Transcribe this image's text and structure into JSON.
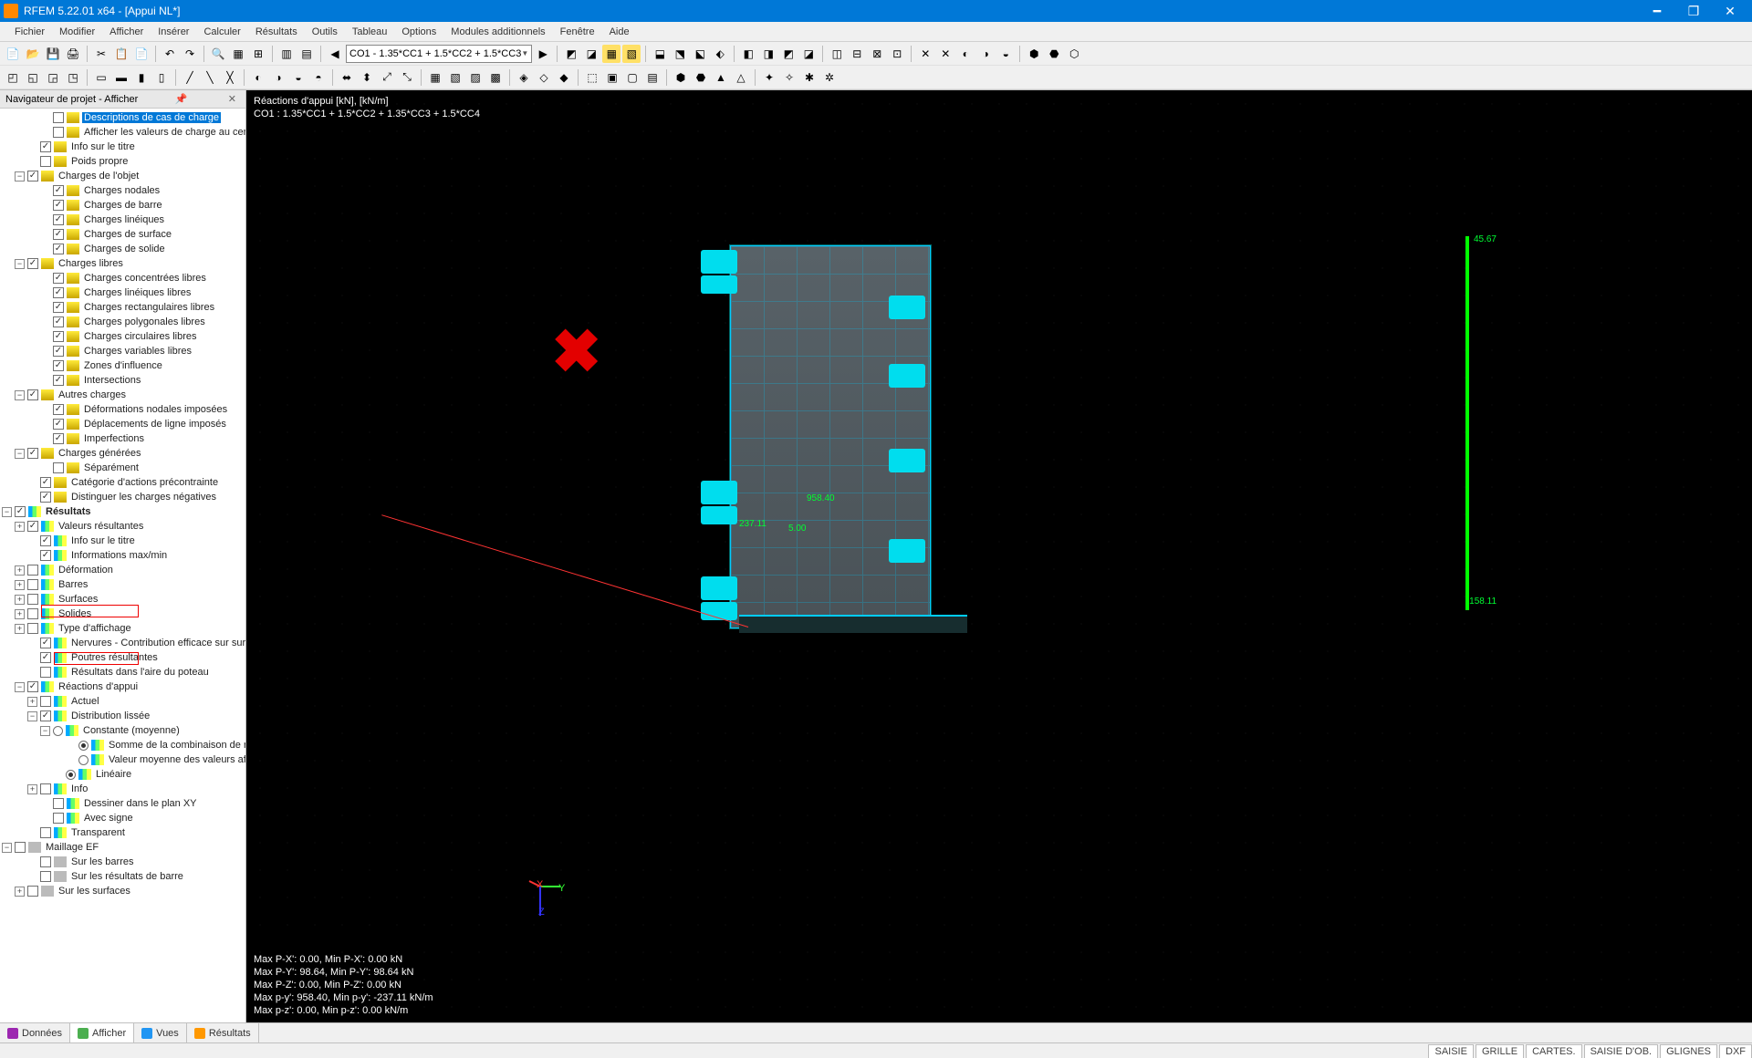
{
  "window": {
    "title": "RFEM 5.22.01 x64 - [Appui NL*]"
  },
  "menu": [
    "Fichier",
    "Modifier",
    "Afficher",
    "Insérer",
    "Calculer",
    "Résultats",
    "Outils",
    "Tableau",
    "Options",
    "Modules additionnels",
    "Fenêtre",
    "Aide"
  ],
  "combo_loadcase": "CO1 - 1.35*CC1 + 1.5*CC2 + 1.5*CC3",
  "panel": {
    "title": "Navigateur de projet - Afficher"
  },
  "tree": {
    "desc_cas": "Descriptions de cas de charge",
    "aff_val": "Afficher les valeurs de charge au centre de la su",
    "info_titre": "Info sur le titre",
    "poids": "Poids propre",
    "charges_objet": "Charges de l'objet",
    "ch_nod": "Charges nodales",
    "ch_barre": "Charges de barre",
    "ch_lin": "Charges linéiques",
    "ch_surf": "Charges de surface",
    "ch_sol": "Charges de solide",
    "ch_libres": "Charges libres",
    "ch_conc": "Charges concentrées libres",
    "ch_lin_l": "Charges linéiques libres",
    "ch_rect": "Charges rectangulaires libres",
    "ch_poly": "Charges polygonales libres",
    "ch_circ": "Charges circulaires libres",
    "ch_var": "Charges variables libres",
    "zones": "Zones d'influence",
    "intersect": "Intersections",
    "autres": "Autres charges",
    "def_nod": "Déformations nodales imposées",
    "depl_lig": "Déplacements de ligne imposés",
    "imperf": "Imperfections",
    "ch_gen": "Charges générées",
    "sep": "Séparément",
    "cat_actions": "Catégorie d'actions précontrainte",
    "dist_neg": "Distinguer les charges négatives",
    "resultats": "Résultats",
    "val_res": "Valeurs résultantes",
    "info_titre2": "Info sur le titre",
    "info_max": "Informations max/min",
    "deform": "Déformation",
    "barres": "Barres",
    "surfaces": "Surfaces",
    "solides": "Solides",
    "type_aff": "Type d'affichage",
    "nervures": "Nervures - Contribution efficace sur surface/barre",
    "poutres": "Poutres résultantes",
    "res_poteau": "Résultats dans l'aire du poteau",
    "reactions": "Réactions d'appui",
    "actuel": "Actuel",
    "dist_lissee": "Distribution lissée",
    "constante": "Constante (moyenne)",
    "somme": "Somme de la combinaison de résultats",
    "val_moy": "Valeur moyenne des valeurs affichées",
    "lineaire": "Linéaire",
    "info": "Info",
    "dessiner_xy": "Dessiner dans le plan XY",
    "avec_signe": "Avec signe",
    "transparent": "Transparent",
    "maillage": "Maillage EF",
    "sur_barres": "Sur les barres",
    "sur_res_barre": "Sur les résultats de barre",
    "sur_surfaces": "Sur les surfaces"
  },
  "tabs": [
    "Données",
    "Afficher",
    "Vues",
    "Résultats"
  ],
  "viewport": {
    "header1": "Réactions d'appui   [kN], [kN/m]",
    "header2": "CO1 : 1.35*CC1 + 1.5*CC2 + 1.35*CC3 + 1.5*CC4",
    "val_top": "45.67",
    "val_mid": "958.40",
    "val_5": "5.00",
    "val_bottom": "158.11",
    "val_left": "237.11",
    "stats": [
      "Max P-X': 0.00, Min P-X': 0.00 kN",
      "Max P-Y': 98.64, Min P-Y': 98.64 kN",
      "Max P-Z': 0.00, Min P-Z': 0.00 kN",
      "Max p-y': 958.40, Min p-y': -237.11 kN/m",
      "Max p-z': 0.00, Min p-z': 0.00 kN/m"
    ]
  },
  "statusbar": [
    "SAISIE",
    "GRILLE",
    "CARTES.",
    "SAISIE D'OB.",
    "GLIGNES",
    "DXF"
  ]
}
